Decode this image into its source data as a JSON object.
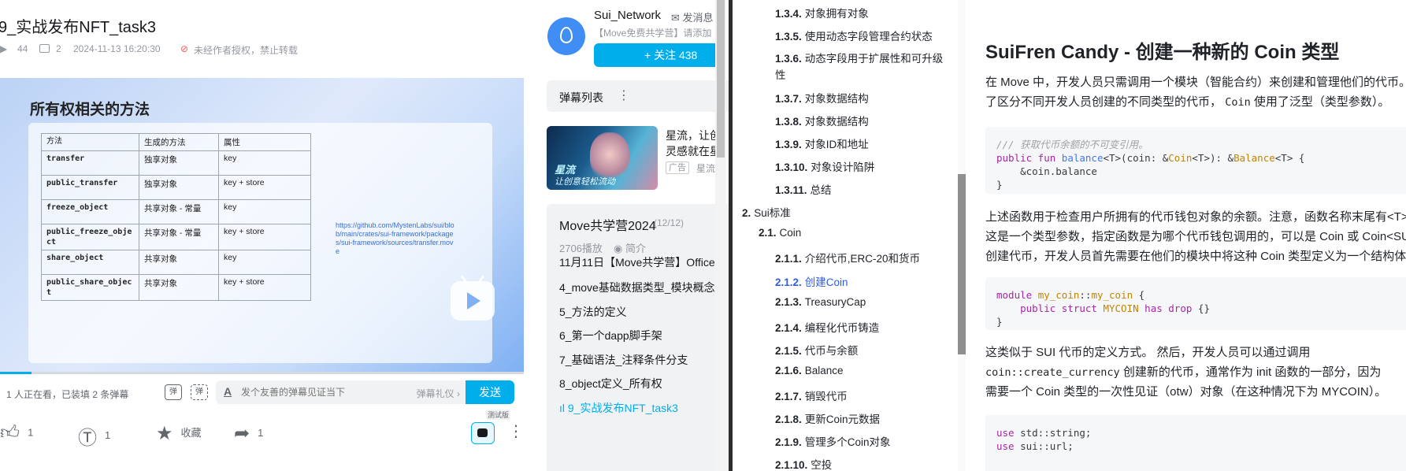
{
  "video": {
    "title": "9_实战发布NFT_task3",
    "play_count": "44",
    "danmaku_count": "2",
    "published": "2024-11-13 16:20:30",
    "copyright": "未经作者授权，禁止转载",
    "progress_fraction": 0.06
  },
  "slide": {
    "title": "所有权相关的方法",
    "headers": [
      "方法",
      "生成的方法",
      "属性"
    ],
    "rows": [
      [
        "transfer",
        "独享对象",
        "key"
      ],
      [
        "public_transfer",
        "独享对象",
        "key + store"
      ],
      [
        "freeze_object",
        "共享对象 - 常量",
        "key"
      ],
      [
        "public_freeze_object",
        "共享对象 - 常量",
        "key + store"
      ],
      [
        "share_object",
        "共享对象",
        "key"
      ],
      [
        "public_share_object",
        "共享对象",
        "key + store"
      ]
    ],
    "link": "https://github.com/MystenLabs/sui/blob/main/crates/sui-framework/packages/sui-framework/sources/transfer.move"
  },
  "danmaku_bar": {
    "viewers": "1 人正在看，已装填 2 条弹幕",
    "toggle_on": "弹",
    "toggle_settings": "弹",
    "input_placeholder": "发个友善的弹幕见证当下",
    "etiquette": "弹幕礼仪 ›",
    "send": "发送"
  },
  "actions": {
    "like": "1",
    "coin": "1",
    "favorite": "收藏",
    "share": "1",
    "beta": "测试版"
  },
  "uploader": {
    "name": "Sui_Network",
    "send_message": "发消息",
    "desc": "【Move免费共学营】请添加",
    "follow": "+ 关注 438"
  },
  "danmaku_list": {
    "label": "弹幕列表",
    "more": "⋮"
  },
  "ad": {
    "line1": "星流，让创",
    "line2": "灵感就在星",
    "tag": "广告",
    "source": "星流",
    "img_text1": "星流",
    "img_text2": "让创意轻松流动"
  },
  "playlist": {
    "title": "Move共学营2024",
    "count": "(12/12)",
    "plays": "2706播放",
    "intro": "简介",
    "items": [
      "11月11日【Move共学营】Office",
      "4_move基础数据类型_模块概念",
      "5_方法的定义",
      "6_第一个dapp脚手架",
      "7_基础语法_注释条件分支",
      "8_object定义_所有权",
      "9_实战发布NFT_task3"
    ]
  },
  "toc": {
    "items": [
      {
        "num": "1.3.4.",
        "label": "对象拥有对象"
      },
      {
        "num": "1.3.5.",
        "label": "使用动态字段管理合约状态"
      },
      {
        "num": "1.3.6.",
        "label": "动态字段用于扩展性和可升级"
      },
      {
        "num": "",
        "label": "性"
      },
      {
        "num": "1.3.7.",
        "label": "对象数据结构"
      },
      {
        "num": "1.3.8.",
        "label": "对象数据结构"
      },
      {
        "num": "1.3.9.",
        "label": "对象ID和地址"
      },
      {
        "num": "1.3.10.",
        "label": "对象设计陷阱"
      },
      {
        "num": "1.3.11.",
        "label": "总结"
      },
      {
        "num": "2.",
        "label": "Sui标准"
      },
      {
        "num": "2.1.",
        "label": "Coin"
      },
      {
        "num": "2.1.1.",
        "label": "介绍代币,ERC-20和货币"
      },
      {
        "num": "2.1.2.",
        "label": "创建Coin"
      },
      {
        "num": "2.1.3.",
        "label": "TreasuryCap"
      },
      {
        "num": "2.1.4.",
        "label": "编程化代币铸造"
      },
      {
        "num": "2.1.5.",
        "label": "代币与余额"
      },
      {
        "num": "2.1.6.",
        "label": "Balance"
      },
      {
        "num": "2.1.7.",
        "label": "销毁代币"
      },
      {
        "num": "2.1.8.",
        "label": "更新Coin元数据"
      },
      {
        "num": "2.1.9.",
        "label": "管理多个Coin对象"
      },
      {
        "num": "2.1.10.",
        "label": "空投"
      }
    ]
  },
  "article": {
    "title": "SuiFren Candy - 创建一种新的 Coin 类型",
    "p1a": "在 Move 中，开发人员只需调用一个模块（智能合约）来创建和管理他们的代币。为",
    "p1b_pre": "了区分不同开发人员创建的不同类型的代币，",
    "p1b_code": "Coin",
    "p1b_post": " 使用了泛型（类型参数）。",
    "code1_comment": "/// 获取代币余额的不可变引用。",
    "p2a": "上述函数用于检查用户所拥有的代币钱包对象的余额。注意，函数名称末尾有<T>，",
    "p2b": "这是一个类型参数，指定函数是为哪个代币钱包调用的，可以是 Coin 或 Coin<SUI>。为了",
    "p2c": "创建代币，开发人员首先需要在他们的模块中将这种 Coin 类型定义为一个结构体。",
    "p3a": "这类似于 SUI 代币的定义方式。 然后，开发人员可以通过调用",
    "p3b_code": "coin::create_currency",
    "p3b_post": " 创建新的代币，通常作为 init 函数的一部分，因为",
    "p3c": "需要一个 Coin 类型的一次性见证（otw）对象（在这种情况下为 MYCOIN）。"
  }
}
